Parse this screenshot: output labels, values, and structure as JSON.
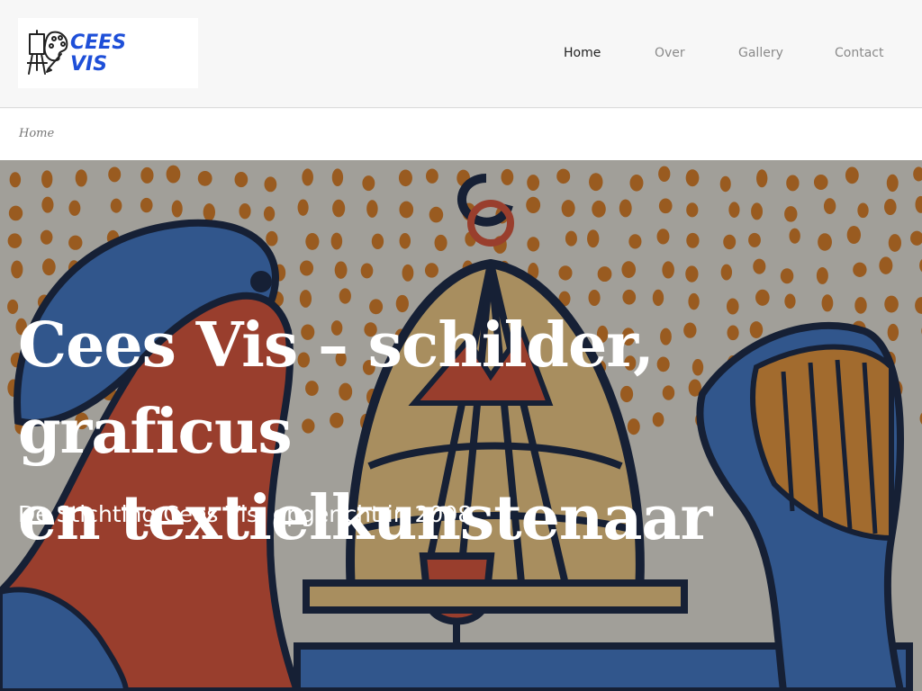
{
  "site": {
    "logo": {
      "line1": "CEES",
      "line2": "VIS",
      "icon": "easel-palette-icon",
      "color": "#1e4fd8"
    },
    "nav": [
      {
        "label": "Home",
        "active": true
      },
      {
        "label": "Over",
        "active": false
      },
      {
        "label": "Gallery",
        "active": false
      },
      {
        "label": "Contact",
        "active": false
      }
    ]
  },
  "breadcrumb": {
    "current": "Home"
  },
  "hero": {
    "title_line1": "Cees Vis – schilder, graficus",
    "title_line2": "en textielkunstenaar",
    "subtitle": "De Stichting Cees Vis, opgericht in 2008",
    "background": "colourful-linocut-artwork-birdcage"
  }
}
